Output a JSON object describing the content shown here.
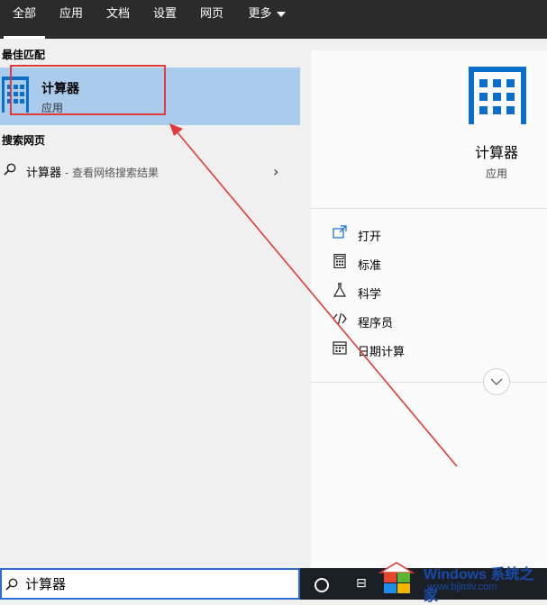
{
  "tabs": [
    {
      "label": "全部",
      "active": true
    },
    {
      "label": "应用"
    },
    {
      "label": "文档"
    },
    {
      "label": "设置"
    },
    {
      "label": "网页"
    },
    {
      "label": "更多"
    }
  ],
  "left": {
    "best_match_title": "最佳匹配",
    "best_match": {
      "name": "计算器",
      "type": "应用",
      "icon": "calculator-icon"
    },
    "web_title": "搜索网页",
    "web_result": {
      "query": "计算器",
      "suffix": " - 查看网络搜索结果"
    }
  },
  "right": {
    "app_name": "计算器",
    "app_type": "应用",
    "actions": [
      {
        "label": "打开",
        "icon": "open-icon"
      },
      {
        "label": "标准",
        "icon": "calculator-standard-icon"
      },
      {
        "label": "科学",
        "icon": "flask-icon"
      },
      {
        "label": "程序员",
        "icon": "code-icon"
      },
      {
        "label": "日期计算",
        "icon": "calendar-icon"
      }
    ]
  },
  "search": {
    "value": "计算器"
  },
  "watermark": {
    "brand": "Windows",
    "cn": "系统之家",
    "url": "www.bjjmlv.com"
  },
  "colors": {
    "topbar": "#2b2b2b",
    "selected": "#a9cbec",
    "accent": "#0a6fc9",
    "annotation": "#e23a3a"
  }
}
